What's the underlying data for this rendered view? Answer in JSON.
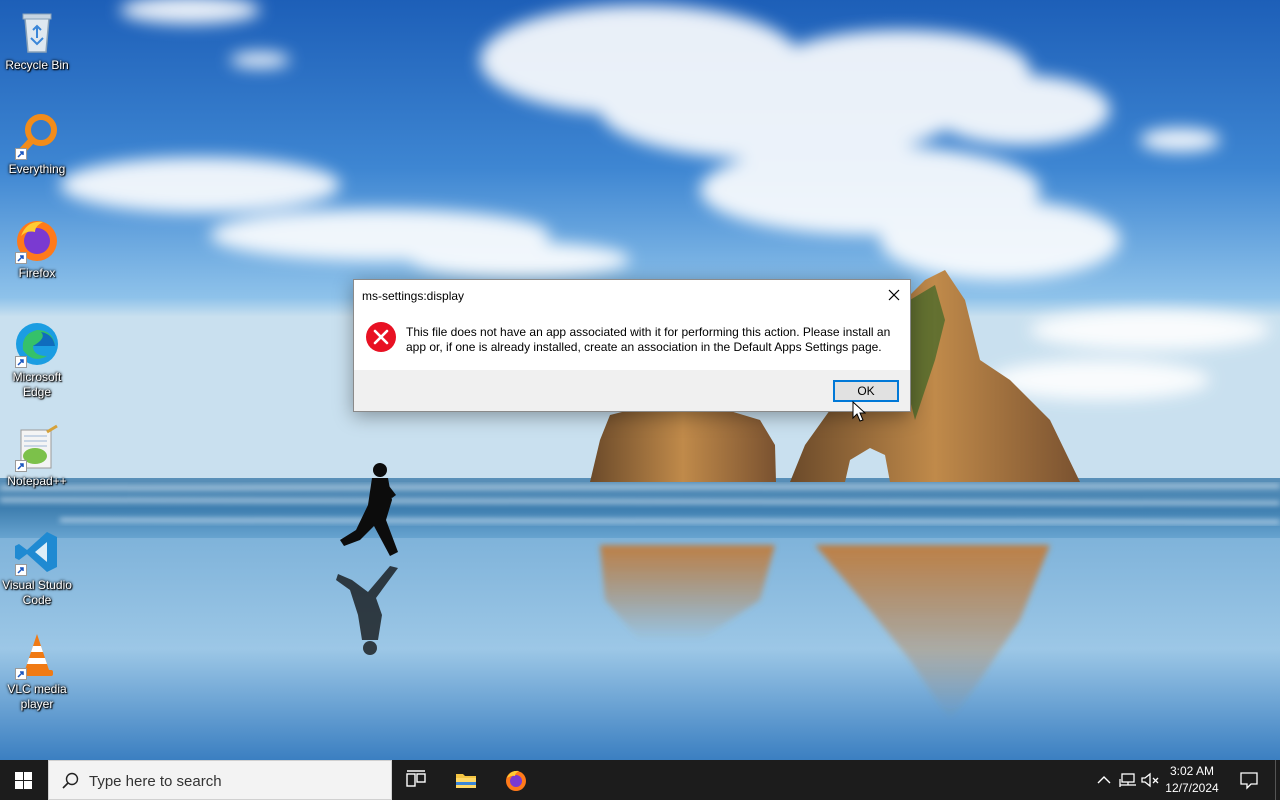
{
  "desktop": {
    "icons": [
      {
        "label": "Recycle Bin",
        "icon": "recycle-bin-icon",
        "shortcut": false
      },
      {
        "label": "Everything",
        "icon": "everything-search-icon",
        "shortcut": true
      },
      {
        "label": "Firefox",
        "icon": "firefox-icon",
        "shortcut": true
      },
      {
        "label": "Microsoft Edge",
        "icon": "edge-icon",
        "shortcut": true
      },
      {
        "label": "Notepad++",
        "icon": "notepadpp-icon",
        "shortcut": true
      },
      {
        "label": "Visual Studio Code",
        "icon": "vscode-icon",
        "shortcut": true
      },
      {
        "label": "VLC media player",
        "icon": "vlc-icon",
        "shortcut": true
      }
    ]
  },
  "dialog": {
    "title": "ms-settings:display",
    "message": "This file does not have an app associated with it for performing this action. Please install an app or, if one is already installed, create an association in the Default Apps Settings page.",
    "ok_label": "OK",
    "icon": "error-icon"
  },
  "taskbar": {
    "search_placeholder": "Type here to search",
    "pinned": [
      {
        "name": "task-view",
        "icon": "task-view-icon"
      },
      {
        "name": "file-explorer",
        "icon": "folder-icon"
      },
      {
        "name": "firefox",
        "icon": "firefox-icon"
      }
    ],
    "tray": {
      "time": "3:02 AM",
      "date": "12/7/2024",
      "icons": [
        "chevron-up-icon",
        "network-icon",
        "volume-muted-icon"
      ]
    }
  },
  "colors": {
    "accent": "#0078d7",
    "error": "#e81123",
    "taskbar": "#1c1c1c"
  }
}
